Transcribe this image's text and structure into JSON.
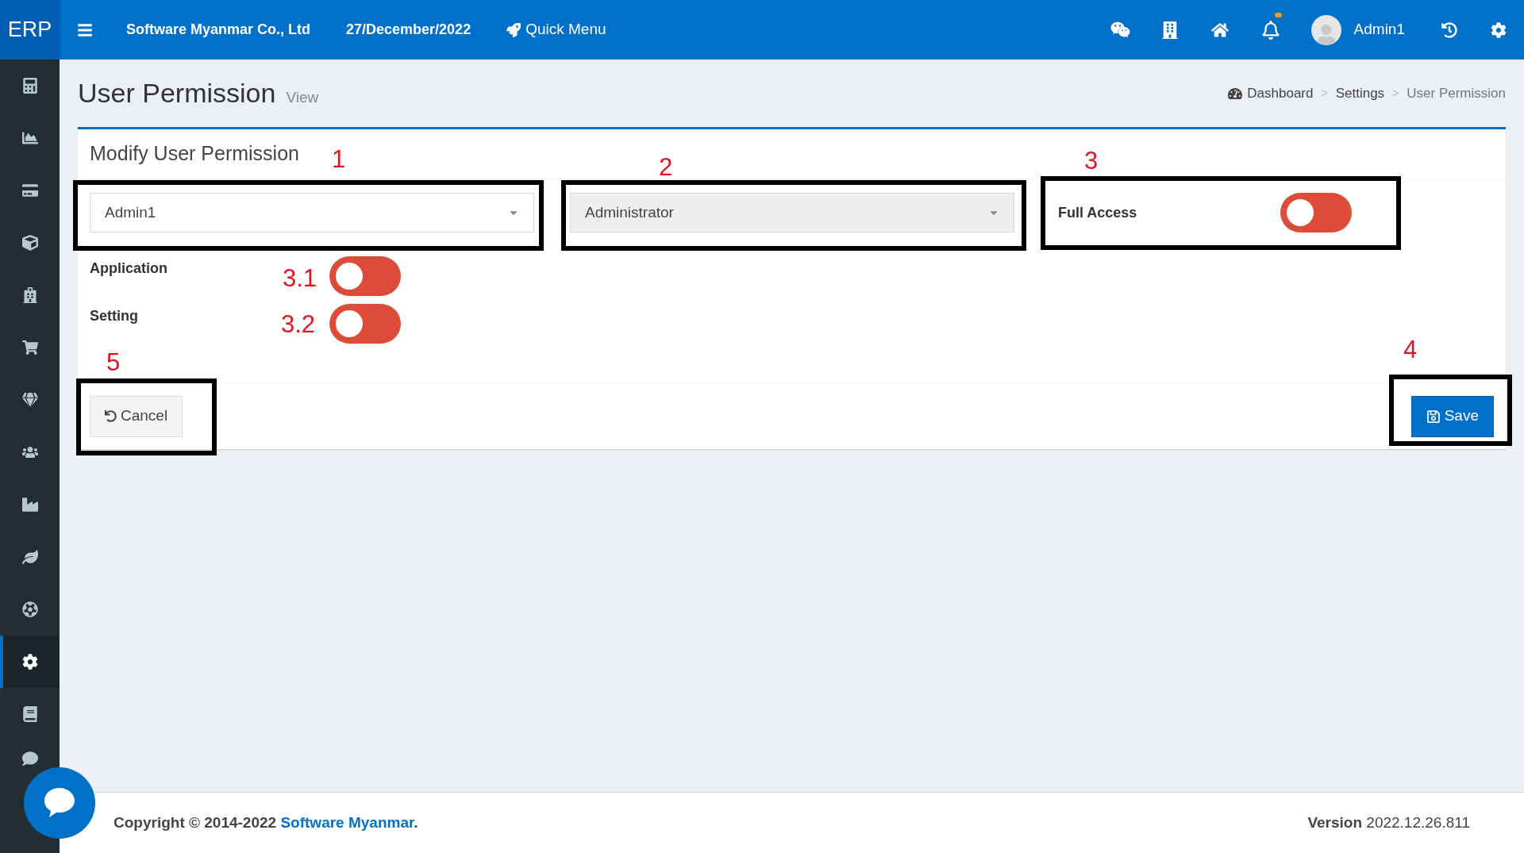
{
  "topbar": {
    "logo": "ERP",
    "company": "Software Myanmar Co., Ltd",
    "date": "27/December/2022",
    "quick_menu": "Quick Menu",
    "notification_dot": true,
    "user": "Admin1"
  },
  "sidebar": {
    "items": [
      {
        "selected": false
      },
      {
        "selected": false
      },
      {
        "selected": false
      },
      {
        "selected": false
      },
      {
        "selected": false
      },
      {
        "selected": false
      },
      {
        "selected": false
      },
      {
        "selected": false
      },
      {
        "selected": false
      },
      {
        "selected": false
      },
      {
        "selected": false
      },
      {
        "selected": true
      },
      {
        "selected": false
      },
      {
        "selected": false
      }
    ]
  },
  "page": {
    "title": "User Permission",
    "subtitle": "View"
  },
  "breadcrumb": {
    "items": [
      {
        "label": "Dashboard",
        "current": false
      },
      {
        "label": "Settings",
        "current": false
      },
      {
        "label": "User Permission",
        "current": true
      }
    ],
    "separators": [
      ">",
      ">"
    ]
  },
  "card": {
    "title": "Modify User Permission",
    "user_select": {
      "value": "Admin1",
      "disabled": false
    },
    "role_select": {
      "value": "Administrator",
      "disabled": true
    },
    "full_access": {
      "label": "Full Access",
      "on": false
    },
    "permissions": [
      {
        "label": "Application",
        "on": false
      },
      {
        "label": "Setting",
        "on": false
      }
    ],
    "cancel": "Cancel",
    "save": "Save"
  },
  "annotations": [
    "1",
    "2",
    "3",
    "3.1",
    "3.2",
    "4",
    "5"
  ],
  "footer": {
    "copyright": "Copyright © 2014-2022",
    "company_link": "Software Myanmar",
    "period": ".",
    "version_label": "Version",
    "version": "2022.12.26.811"
  }
}
